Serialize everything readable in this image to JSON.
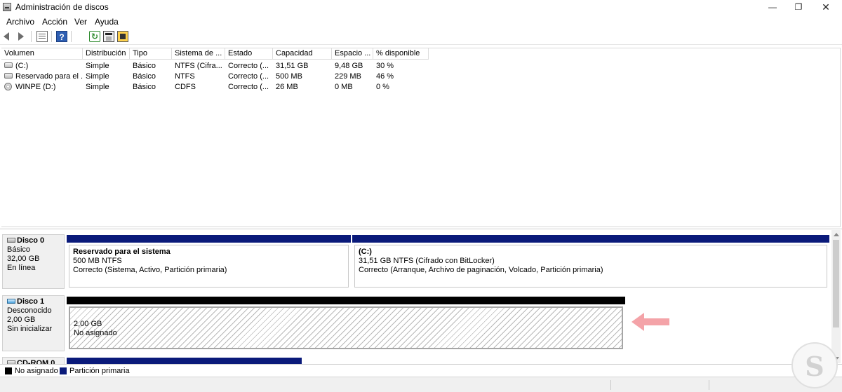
{
  "window": {
    "title": "Administración de discos",
    "minimize_glyph": "—",
    "maximize_glyph": "❐",
    "close_glyph": "✕"
  },
  "menu": [
    {
      "label": "Archivo"
    },
    {
      "label": "Acción"
    },
    {
      "label": "Ver"
    },
    {
      "label": "Ayuda"
    }
  ],
  "toolbar": {
    "icons": [
      "back-arrow-icon",
      "forward-arrow-icon",
      "list-view-icon",
      "help-icon",
      "refresh-icon",
      "properties-icon",
      "wizard-icon"
    ],
    "help_glyph": "?",
    "refresh_glyph": "↻"
  },
  "volume_list": {
    "columns": [
      "Volumen",
      "Distribución",
      "Tipo",
      "Sistema de ...",
      "Estado",
      "Capacidad",
      "Espacio ...",
      "% disponible"
    ],
    "rows": [
      {
        "icon": "drive-icon",
        "cells": [
          "(C:)",
          "Simple",
          "Básico",
          "NTFS (Cifra...",
          "Correcto (...",
          "31,51 GB",
          "9,48 GB",
          "30 %"
        ]
      },
      {
        "icon": "drive-icon",
        "cells": [
          "Reservado para el ...",
          "Simple",
          "Básico",
          "NTFS",
          "Correcto (...",
          "500 MB",
          "229 MB",
          "46 %"
        ]
      },
      {
        "icon": "cdrom-icon",
        "cells": [
          "WINPE (D:)",
          "Simple",
          "Básico",
          "CDFS",
          "Correcto (...",
          "26 MB",
          "0 MB",
          "0 %"
        ]
      }
    ]
  },
  "disks": [
    {
      "name": "Disco 0",
      "type": "Básico",
      "size": "32,00 GB",
      "status": "En línea",
      "partitions": [
        {
          "name": "Reservado para el sistema",
          "size_fs": "500 MB NTFS",
          "status": "Correcto (Sistema, Activo, Partición primaria)"
        },
        {
          "name": "(C:)",
          "size_fs": "31,51 GB NTFS (Cifrado con BitLocker)",
          "status": "Correcto (Arranque, Archivo de paginación, Volcado, Partición primaria)"
        }
      ]
    },
    {
      "name": "Disco 1",
      "type": "Desconocido",
      "size": "2,00 GB",
      "status": "Sin inicializar",
      "partitions": [
        {
          "size_fs": "2,00 GB",
          "status": "No asignado"
        }
      ]
    },
    {
      "name": "CD-ROM 0"
    }
  ],
  "legend": [
    {
      "label": "No asignado",
      "color": "#000000"
    },
    {
      "label": "Partición primaria",
      "color": "#0a1a7a"
    }
  ],
  "colors": {
    "primary_partition": "#0a1a7a",
    "unallocated": "#000000",
    "annotation_arrow": "#f4a3a8"
  }
}
